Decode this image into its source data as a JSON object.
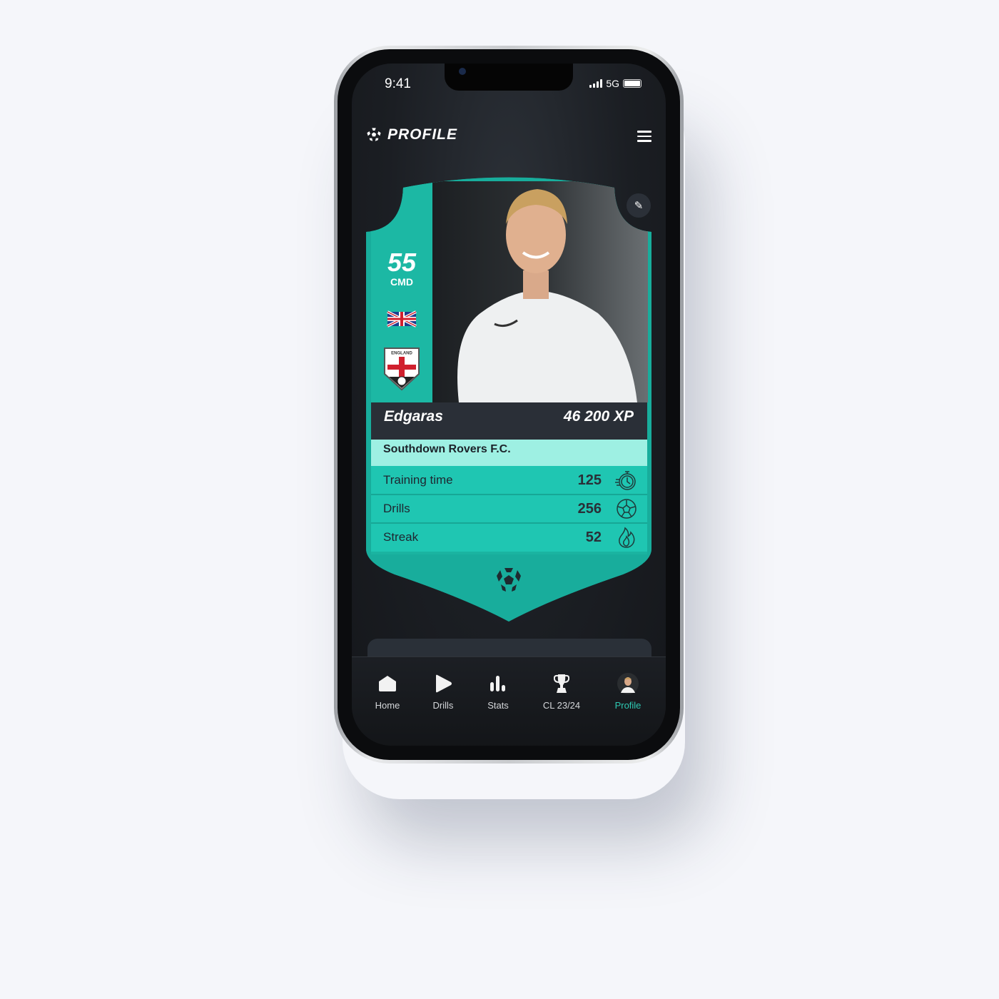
{
  "status_bar": {
    "time": "9:41",
    "network": "5G"
  },
  "header": {
    "title": "PROFILE",
    "logo_icon": "football-icon",
    "menu_icon": "hamburger-icon"
  },
  "card": {
    "rating": "55",
    "position": "CMD",
    "nationality_flag": "uk-flag-icon",
    "team_badge": "england-badge-icon",
    "badge_text": "ENGLAND",
    "player_name": "Edgaras",
    "xp": "46 200 XP",
    "club": "Southdown Rovers F.C.",
    "stats": [
      {
        "label": "Training time",
        "value": "125",
        "icon": "stopwatch-icon"
      },
      {
        "label": "Drills",
        "value": "256",
        "icon": "football-icon"
      },
      {
        "label": "Streak",
        "value": "52",
        "icon": "flame-icon"
      }
    ],
    "colors": {
      "teal": "#1fc6b2",
      "teal_dark": "#18ad9c",
      "club_bar": "#9ef0e3",
      "name_bar": "#2a2f37"
    }
  },
  "nav": {
    "items": [
      {
        "label": "Home",
        "icon": "home-icon"
      },
      {
        "label": "Drills",
        "icon": "play-icon"
      },
      {
        "label": "Stats",
        "icon": "bar-chart-icon"
      },
      {
        "label": "CL 23/24",
        "icon": "trophy-icon"
      },
      {
        "label": "Profile",
        "icon": "avatar",
        "active": true
      }
    ],
    "active_color": "#2ec9b3"
  }
}
